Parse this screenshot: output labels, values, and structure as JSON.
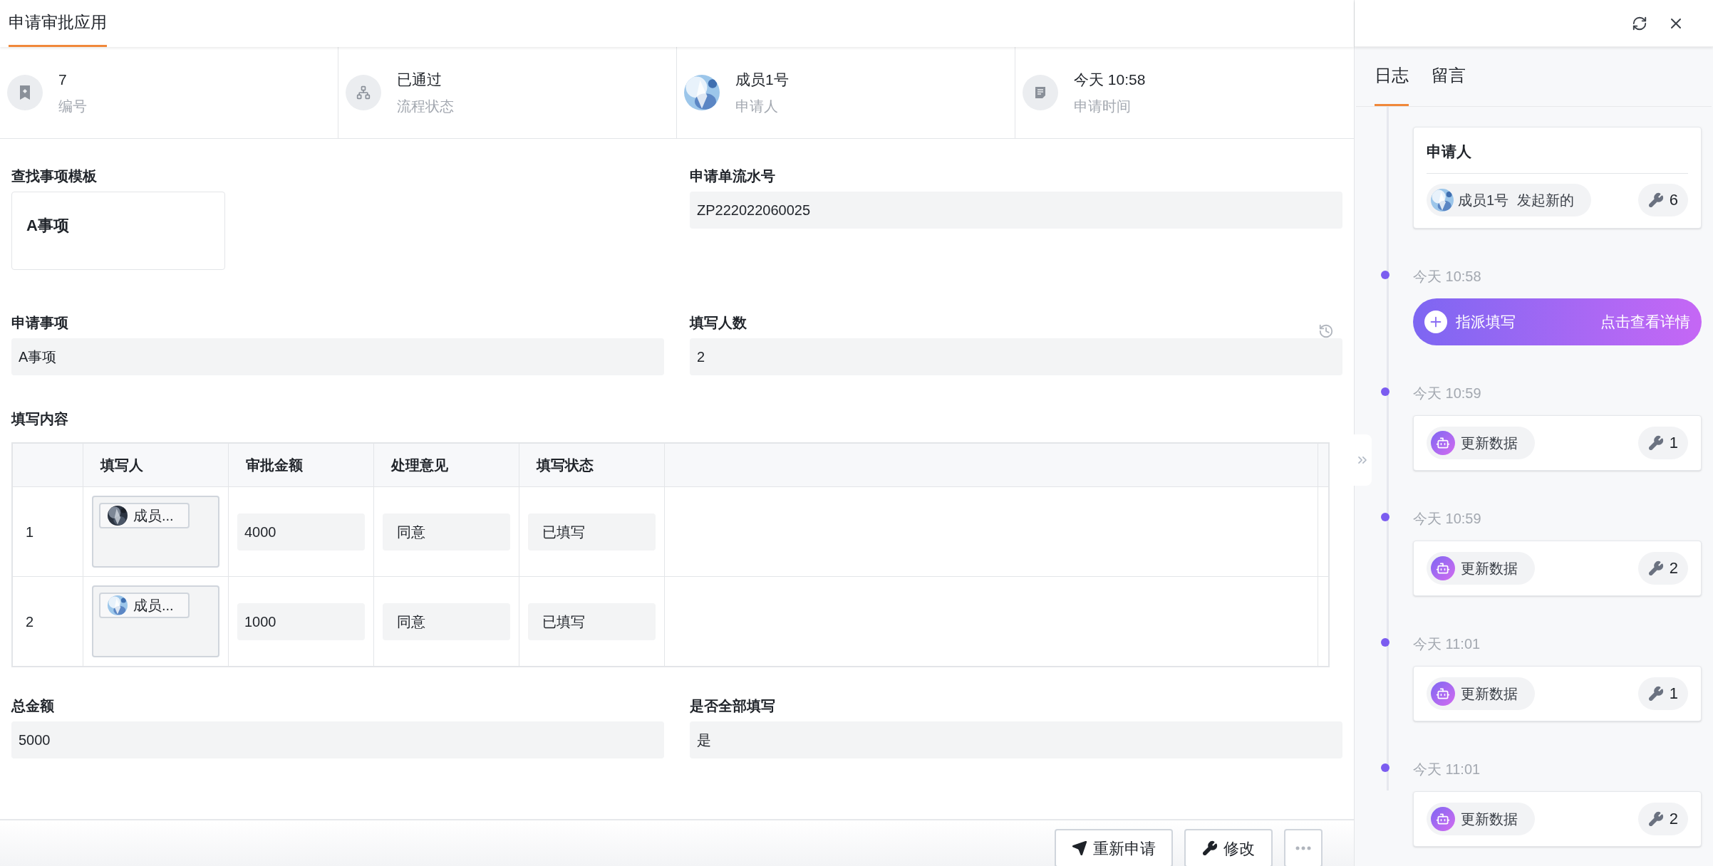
{
  "window": {
    "title": "申请审批应用",
    "selected": true
  },
  "info": [
    {
      "kind": "bookmark",
      "value": "7",
      "label": "编号"
    },
    {
      "kind": "flow",
      "value": "已通过",
      "label": "流程状态"
    },
    {
      "kind": "avatar",
      "value": "成员1号",
      "label": "申请人"
    },
    {
      "kind": "note",
      "value": "今天 10:58",
      "label": "申请时间"
    }
  ],
  "fields_top": [
    {
      "kind": "card",
      "label": "查找事项模板",
      "value": "A事项"
    },
    {
      "kind": "input",
      "label": "申请单流水号",
      "value": "ZP222022060025"
    },
    {
      "kind": "input",
      "label": "申请事项",
      "value": "A事项"
    },
    {
      "kind": "count",
      "label": "填写人数",
      "value": "2"
    }
  ],
  "table": {
    "label": "填写内容",
    "columns": [
      "填写人",
      "审批金额",
      "处理意见",
      "填写状态"
    ],
    "rows": [
      {
        "index": "1",
        "filler": "成员...",
        "amount": "4000",
        "opinion": "同意",
        "status": "已填写"
      },
      {
        "index": "2",
        "filler": "成员...",
        "amount": "1000",
        "opinion": "同意",
        "status": "已填写"
      }
    ]
  },
  "fields_bottom": [
    {
      "label": "总金额",
      "value": "5000"
    },
    {
      "label": "是否全部填写",
      "value": "是"
    }
  ],
  "footer_buttons": [
    {
      "kind": "send",
      "label": "重新申请"
    },
    {
      "kind": "wrench",
      "label": "修改"
    },
    {
      "kind": "more"
    }
  ],
  "side_tabs": [
    {
      "label": "日志",
      "selected": true
    },
    {
      "label": "留言",
      "selected": false
    }
  ],
  "log": [
    {
      "kind": "start",
      "title": "申请人",
      "actor": "成员1号",
      "action": "发起新的",
      "count": "6"
    },
    {
      "kind": "assign",
      "time": "今天 10:58",
      "label": "指派填写",
      "link": "点击查看详情"
    },
    {
      "kind": "update",
      "time": "今天 10:59",
      "label": "更新数据",
      "count": "1"
    },
    {
      "kind": "update",
      "time": "今天 10:59",
      "label": "更新数据",
      "count": "2"
    },
    {
      "kind": "update",
      "time": "今天 11:01",
      "label": "更新数据",
      "count": "1"
    },
    {
      "kind": "update",
      "time": "今天 11:01",
      "label": "更新数据",
      "count": "2"
    }
  ]
}
